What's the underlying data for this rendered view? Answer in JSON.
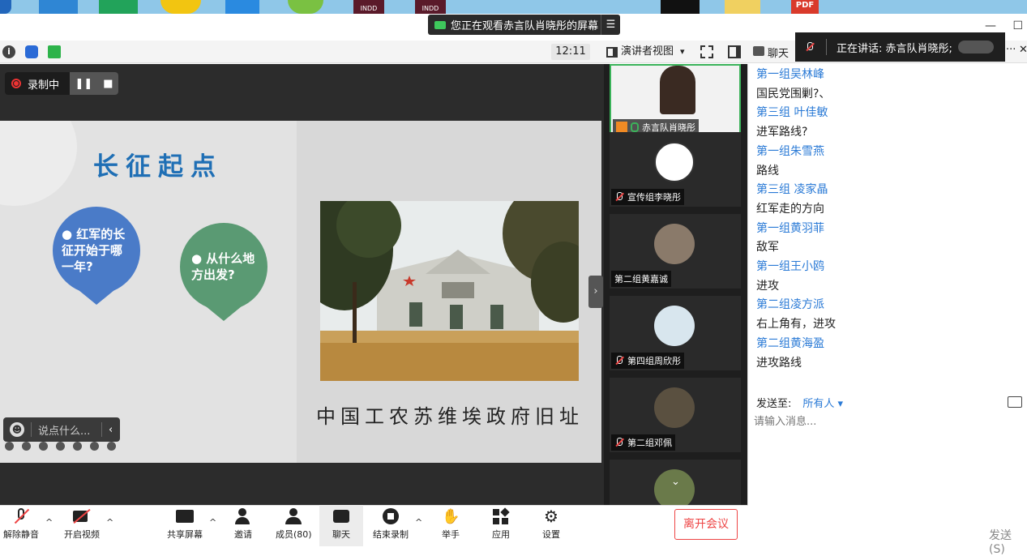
{
  "desktop": {
    "badges": [
      "INDD",
      "INDD",
      "PDF"
    ]
  },
  "banner": {
    "text": "您正在观看赤言队肖晓彤的屏幕",
    "menu_icon": "list-icon"
  },
  "toolbar": {
    "time": "12:11",
    "speaker_view": "演讲者视图",
    "speaker_view_caret": "▾",
    "chat_label": "聊天",
    "speaking_text": "正在讲话: 赤言队肖晓彤;",
    "more": "···",
    "close": "✕"
  },
  "window_controls": {
    "minimize": "—",
    "maximize": "☐"
  },
  "recording": {
    "label": "录制中",
    "pause": "❚❚",
    "stop": "■"
  },
  "slide": {
    "title": "长征起点",
    "bubble1": "● 红军的长征开始于哪一年?",
    "bubble2": "● 从什么地方出发?",
    "caption": "中国工农苏维埃政府旧址"
  },
  "reaction": {
    "placeholder": "说点什么...",
    "collapse": "‹"
  },
  "gallery": {
    "tiles": [
      {
        "name": "赤言队肖晓彤",
        "muted": false
      },
      {
        "name": "宣传组李晓彤",
        "muted": true
      },
      {
        "name": "第二组黄嘉诚",
        "muted": false
      },
      {
        "name": "第四组周欣彤",
        "muted": true
      },
      {
        "name": "第二组邓佩",
        "muted": true
      }
    ],
    "expand": "›",
    "scroll_down": "⌄"
  },
  "chat": {
    "messages": [
      {
        "name": "第一组吴林峰",
        "text": "国民党围剿?、"
      },
      {
        "name": "第三组 叶佳敏",
        "text": "进军路线?"
      },
      {
        "name": "第一组朱雪燕",
        "text": "路线"
      },
      {
        "name": "第三组 凌家晶",
        "text": "红军走的方向"
      },
      {
        "name": "第一组黄羽菲",
        "text": "敌军"
      },
      {
        "name": "第一组王小鸥",
        "text": "进攻"
      },
      {
        "name": "第二组凌方派",
        "text": "右上角有，进攻"
      },
      {
        "name": "第二组黄海盈",
        "text": "进攻路线"
      }
    ],
    "send_to_label": "发送至:",
    "send_to_value": "所有人 ▾",
    "input_placeholder": "请输入消息...",
    "send_button": "发送(S)"
  },
  "bottom_bar": {
    "unmute": "解除静音",
    "start_video": "开启视频",
    "share_screen": "共享屏幕",
    "invite": "邀请",
    "members": "成员(80)",
    "chat": "聊天",
    "end_recording": "结束录制",
    "raise_hand": "举手",
    "apps": "应用",
    "settings": "设置",
    "leave": "离开会议",
    "caret": "^"
  },
  "colors": {
    "accent_blue": "#2a7ad6",
    "leave_red": "#e44444",
    "speaking_green": "#3bb35a"
  }
}
